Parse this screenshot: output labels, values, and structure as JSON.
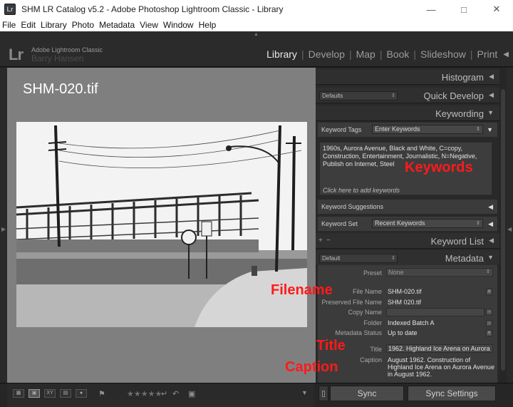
{
  "window": {
    "title": "SHM LR Catalog v5.2 - Adobe Photoshop Lightroom Classic - Library",
    "app_icon": "Lr",
    "controls": [
      "minimize-icon",
      "maximize-icon",
      "close-icon"
    ]
  },
  "menubar": {
    "items": [
      "File",
      "Edit",
      "Library",
      "Photo",
      "Metadata",
      "View",
      "Window",
      "Help"
    ]
  },
  "identity": {
    "logo": "Lr",
    "app_name": "Adobe Lightroom Classic",
    "user": "Barry Hansen"
  },
  "modules": [
    {
      "label": "Library",
      "active": true
    },
    {
      "label": "Develop",
      "active": false
    },
    {
      "label": "Map",
      "active": false
    },
    {
      "label": "Book",
      "active": false
    },
    {
      "label": "Slideshow",
      "active": false
    },
    {
      "label": "Print",
      "active": false
    }
  ],
  "image": {
    "filename_overlay": "SHM-020.tif"
  },
  "panels": {
    "histogram": {
      "title": "Histogram"
    },
    "quick_develop": {
      "title": "Quick Develop",
      "preset": "Defaults"
    },
    "keywording": {
      "title": "Keywording",
      "keyword_tags_label": "Keyword Tags",
      "keyword_tags_mode": "Enter Keywords",
      "keywords_text": "1960s, Aurora Avenue, Black and White, C=copy, Construction, Entertainment, Journalistic, N=Negative, Publish on Internet, Steel",
      "add_hint": "Click here to add keywords",
      "suggestions_label": "Keyword Suggestions",
      "set_label": "Keyword Set",
      "set_value": "Recent Keywords"
    },
    "keyword_list": {
      "title": "Keyword List",
      "plus": "+",
      "minus": "−"
    },
    "metadata": {
      "title": "Metadata",
      "preset_select": "Default",
      "preset_label": "Preset",
      "preset_value": "None",
      "file_name_label": "File Name",
      "file_name": "SHM-020.tif",
      "preserved_label": "Preserved File Name",
      "preserved": "SHM 020.tif",
      "copy_name_label": "Copy Name",
      "copy_name": "",
      "folder_label": "Folder",
      "folder": "Indexed Batch A",
      "status_label": "Metadata Status",
      "status": "Up to date",
      "title_label": "Title",
      "title_value": "1962. Highland Ice Arena on Aurora",
      "caption_label": "Caption",
      "caption_value": "August 1962. Construction of Highland Ice Arena on Aurora Avenue in August 1962."
    }
  },
  "bottom": {
    "stars": "★★★★★",
    "sync_label": "Sync",
    "sync_settings_label": "Sync Settings"
  },
  "annotations": {
    "keywords": "Keywords",
    "filename": "Filename",
    "title": "Title",
    "caption": "Caption"
  },
  "colors": {
    "active_module": "#e8e8e8",
    "annotation": "#ff1a1a",
    "panel_bg": "#292929"
  }
}
